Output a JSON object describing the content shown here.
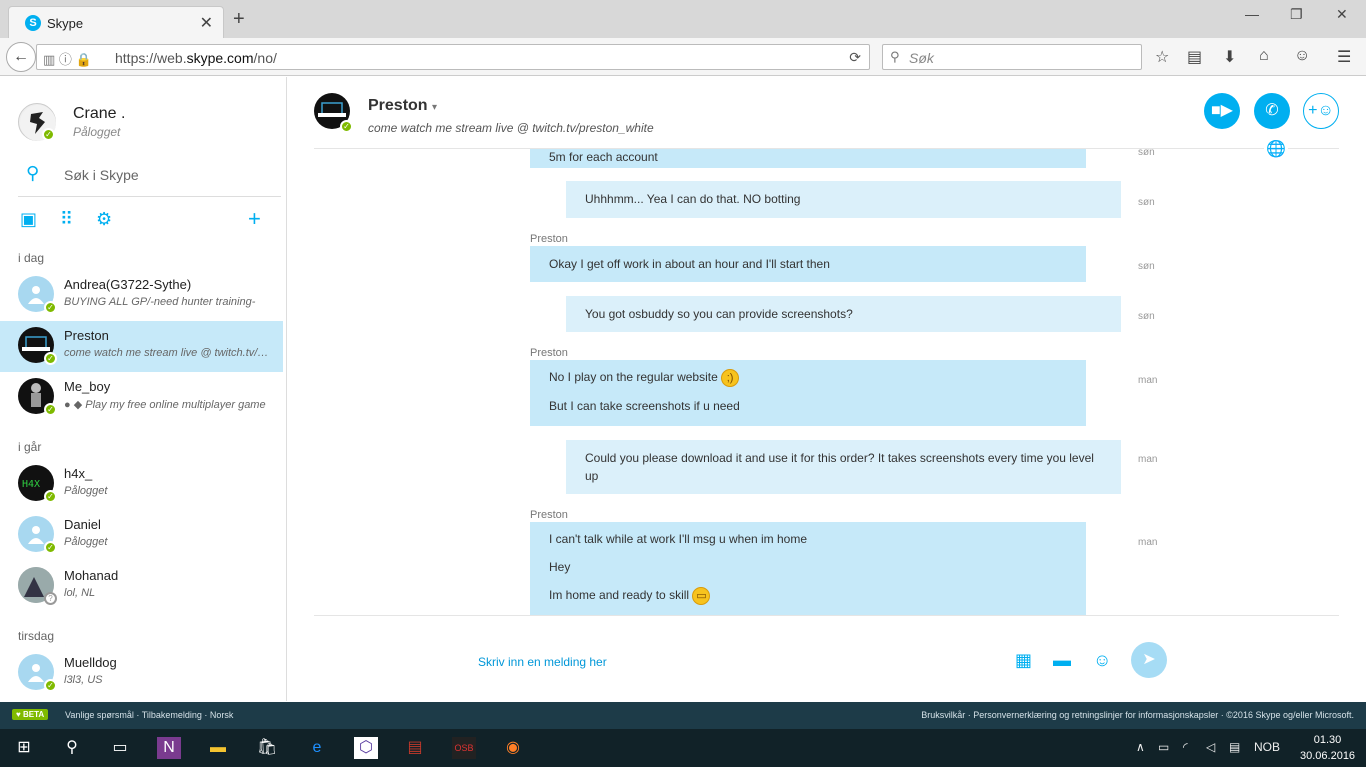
{
  "browser": {
    "tab_title": "Skype",
    "favicon_letter": "S",
    "tab_close": "✕",
    "new_tab": "+",
    "url_prefix": "https://web.",
    "url_host": "skype.com",
    "url_path": "/no/",
    "search_placeholder": "Søk"
  },
  "profile": {
    "name": "Crane .",
    "status": "Pålogget"
  },
  "sidebar": {
    "search_placeholder": "Søk i Skype",
    "groups": [
      {
        "label": "i dag"
      },
      {
        "label": "i går"
      },
      {
        "label": "tirsdag"
      }
    ],
    "contacts": [
      {
        "name": "Andrea(G3722-Sythe)",
        "message": "BUYING ALL GP/-need hunter training-"
      },
      {
        "name": "Preston",
        "message": "come watch me stream live @ twitch.tv/preston_white"
      },
      {
        "name": "Me_boy",
        "message": "Play my free online multiplayer game"
      },
      {
        "name": "h4x_",
        "message": "Pålogget"
      },
      {
        "name": "Daniel",
        "message": "Pålogget"
      },
      {
        "name": "Mohanad",
        "message": "lol, NL"
      },
      {
        "name": "Muelldog",
        "message": "l3l3, US"
      }
    ]
  },
  "chat": {
    "contact_name": "Preston",
    "mood": "come watch me stream live @ twitch.tv/preston_white",
    "sender": "Preston",
    "messages": [
      {
        "text": "5m for each account",
        "time": "søn"
      },
      {
        "text": "Uhhhmm... Yea I can do that. NO botting",
        "time": "søn"
      },
      {
        "text": "Okay I get off work in about an hour and I'll start then",
        "time": "søn"
      },
      {
        "text": "You got osbuddy so you can provide screenshots?",
        "time": "søn"
      },
      {
        "text": "No I play on the regular website",
        "time": "man"
      },
      {
        "text": "But I can take screenshots if u need",
        "time": ""
      },
      {
        "text": "Could you please download it and use it for this order? It takes screenshots every time you level up",
        "time": "man"
      },
      {
        "text": "I can't talk while at work I'll msg u when im home",
        "time": "man"
      },
      {
        "text": "Hey",
        "time": ""
      },
      {
        "text": "Im home and ready to skill",
        "time": ""
      }
    ],
    "composer_placeholder": "Skriv inn en melding her"
  },
  "footer": {
    "beta": "♥ BETA",
    "links_left": "Vanlige spørsmål · Tilbakemelding · Norsk",
    "links_right": "Bruksvilkår · Personvernerklæring og retningslinjer for informasjonskapsler · ©2016 Skype og/eller Microsoft."
  },
  "taskbar": {
    "lang": "NOB",
    "time": "01.30",
    "date": "30.06.2016"
  },
  "colors": {
    "accent": "#00aff0",
    "incoming_bubble": "#c6e9f9",
    "outgoing_bubble": "#dbf0fa",
    "online": "#7fba00"
  }
}
